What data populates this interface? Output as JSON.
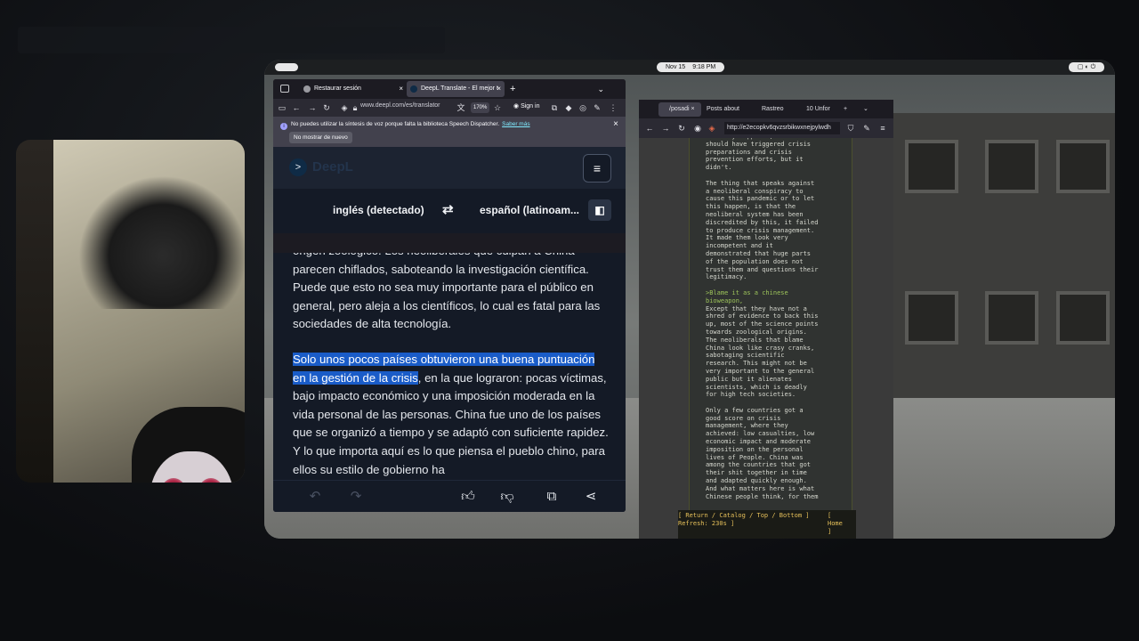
{
  "deepl_browser": {
    "tabs": [
      {
        "label": "Restaurar sesión",
        "close": "×"
      },
      {
        "label": "DeepL Translate - El mejor t",
        "close": "×"
      }
    ],
    "new_tab": "+",
    "tab_list": "⌄",
    "url": "www.deepl.com/es/translator",
    "zoom": "170%",
    "sign_in": "Sign in",
    "notification": {
      "message": "No puedes utilizar la síntesis de voz porque falta la biblioteca Speech Dispatcher.",
      "learn_more": "Saber más",
      "dismiss_button": "No mostrar de nuevo",
      "close": "×"
    },
    "header": {
      "logo_text": "DeepL",
      "menu": "≡"
    },
    "languages": {
      "source": "inglés (detectado)",
      "swap": "⇄",
      "target": "español (latinoam..."
    },
    "text": {
      "paragraph1": "origen zoológico. Los neoliberales que culpan a China parecen chiflados, saboteando la investigación científica. Puede que esto no sea muy importante para el público en general, pero aleja a los científicos, lo cual es fatal para las sociedades de alta tecnología.",
      "paragraph2_highlight": "Solo unos pocos países obtuvieron una buena puntuación en la gestión de la crisis",
      "paragraph2_rest": ", en la que lograron: pocas víctimas, bajo impacto económico y una imposición moderada en la vida personal de las personas. China fue uno de los países que se organizó a tiempo y se adaptó con suficiente rapidez. Y lo que importa aquí es lo que piensa el pueblo chino, para ellos su estilo de gobierno ha"
    }
  },
  "clock": {
    "date": "Nov 15",
    "time": "9:18 PM"
  },
  "tor_browser": {
    "tabs": [
      "/posadi",
      "Posts about",
      "Rastreo",
      "10 Unfor"
    ],
    "url": "http://e2ecopkv6qvzsrbikwxnejpylwdh",
    "post_lines": [
      "actually happened, and that",
      "should have triggered crisis",
      "preparations and crisis",
      "prevention efforts, but it",
      "didn't.",
      "",
      "The thing that speaks against",
      "a neoliberal conspiracy to",
      "cause this pandemic or to let",
      "this happen, is that the",
      "neoliberal system has been",
      "discredited by this, it failed",
      "to produce crisis management.",
      "It made them look very",
      "incompetent and it",
      "demonstrated that huge parts",
      "of the population does not",
      "trust them and questions their",
      "legitimacy."
    ],
    "greentext": [
      ">Blame it as a chinese",
      "bioweapon,"
    ],
    "post_lines2": [
      "Except that they have not a",
      "shred of evidence to back this",
      "up, most of the science points",
      "towards zoological origins.",
      "The neoliberals that blame",
      "China look like crasy cranks,",
      "sabotaging scientific",
      "research. This might not be",
      "very important to the general",
      "public but it alienates",
      "scientists, which is deadly",
      "for high tech societies.",
      "",
      "Only a few countries got a",
      "good score on crisis",
      "management, where they",
      "achieved: low casualties, low",
      "economic impact and moderate",
      "imposition on the personal",
      "lives of People. China was",
      "among the countries that got",
      "their shit together in time",
      "and adapted quickly enough.",
      "And what matters here is what",
      "Chinese people think, for them"
    ],
    "footer_nav": "[ Return / Catalog / Top / Bottom ]",
    "footer_refresh": "Refresh: 230s ]",
    "footer_home": "[ Home ]"
  },
  "colors": {
    "highlight": "#1a5cc8",
    "greentext": "#9cc35a",
    "footer": "#e6c05a"
  }
}
